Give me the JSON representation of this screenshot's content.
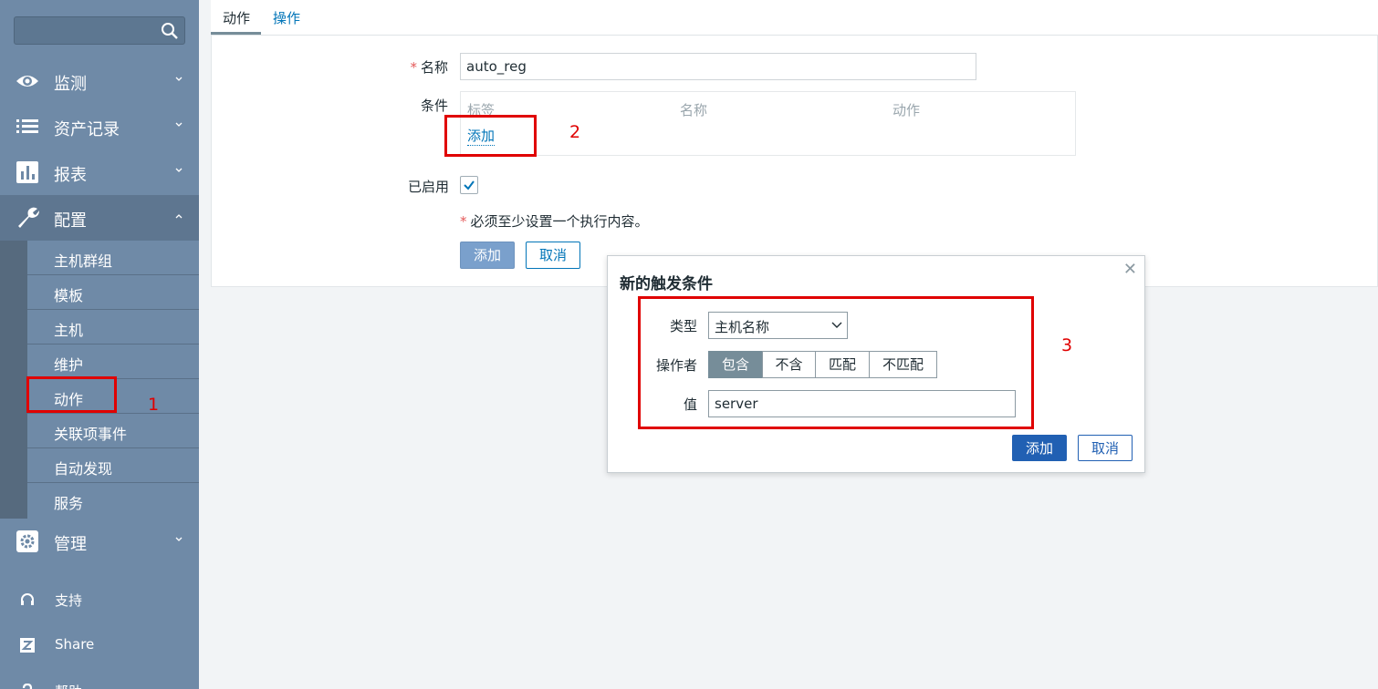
{
  "sidebar": {
    "search": {
      "placeholder": ""
    },
    "menu": [
      {
        "label": "监测",
        "icon": "eye-icon"
      },
      {
        "label": "资产记录",
        "icon": "list-icon"
      },
      {
        "label": "报表",
        "icon": "bar-chart-icon"
      },
      {
        "label": "配置",
        "icon": "wrench-icon"
      },
      {
        "label": "管理",
        "icon": "gear-icon"
      }
    ],
    "config_submenu": [
      "主机群组",
      "模板",
      "主机",
      "维护",
      "动作",
      "关联项事件",
      "自动发现",
      "服务"
    ],
    "footer": [
      {
        "label": "支持",
        "icon": "headset-icon"
      },
      {
        "label": "Share",
        "icon": "share-z-icon"
      },
      {
        "label": "帮助",
        "icon": "help-icon"
      }
    ]
  },
  "tabs": [
    {
      "label": "动作",
      "active": true
    },
    {
      "label": "操作",
      "active": false
    }
  ],
  "form": {
    "name_label": "名称",
    "name_value": "auto_reg",
    "conditions_label": "条件",
    "conditions_columns": [
      "标签",
      "名称",
      "动作"
    ],
    "conditions_add": "添加",
    "enabled_label": "已启用",
    "enabled": true,
    "note": "必须至少设置一个执行内容。",
    "add_button": "添加",
    "cancel_button": "取消"
  },
  "dialog": {
    "title": "新的触发条件",
    "type_label": "类型",
    "type_value": "主机名称",
    "operator_label": "操作者",
    "operators": [
      "包含",
      "不含",
      "匹配",
      "不匹配"
    ],
    "operator_selected": "包含",
    "value_label": "值",
    "value": "server",
    "add_button": "添加",
    "cancel_button": "取消"
  },
  "annotations": [
    "1",
    "2",
    "3"
  ],
  "colors": {
    "sidebar_bg": "#6f8aa7",
    "primary": "#2160b3",
    "link": "#0275b8",
    "annotation_red": "#e00000"
  }
}
